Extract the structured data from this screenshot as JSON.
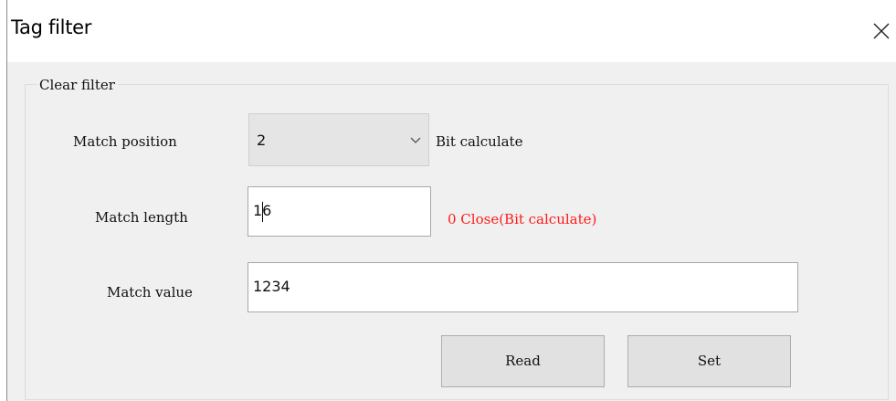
{
  "window": {
    "title": "Tag filter",
    "close_icon": "close-icon"
  },
  "group": {
    "title": "Clear filter"
  },
  "match_position": {
    "label": "Match position",
    "value": "2",
    "dropdown_icon": "chevron-down-icon",
    "side_label": "Bit calculate"
  },
  "match_length": {
    "label": "Match length",
    "value": "16",
    "hint": "0 Close(Bit calculate)",
    "hint_color": "#ff1a1a"
  },
  "match_value": {
    "label": "Match value",
    "value": "1234"
  },
  "buttons": {
    "read_label": "Read",
    "set_label": "Set"
  }
}
